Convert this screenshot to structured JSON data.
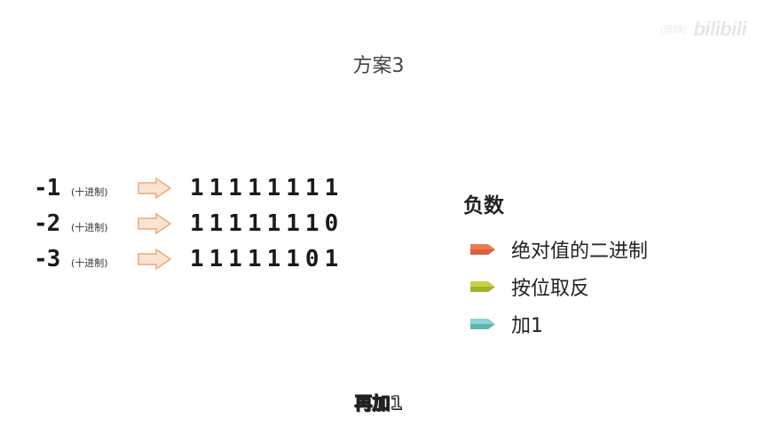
{
  "watermark": {
    "small_text": "(模糊)",
    "logo_text": "bilibili"
  },
  "title": "方案3",
  "rows": [
    {
      "number": "-1",
      "note": "(十进制)",
      "bits": "11111111"
    },
    {
      "number": "-2",
      "note": "(十进制)",
      "bits": "11111110"
    },
    {
      "number": "-3",
      "note": "(十进制)",
      "bits": "11111101"
    }
  ],
  "legend": {
    "heading": "负数",
    "items": [
      {
        "label": "绝对值的二进制",
        "color": "#ee7c50"
      },
      {
        "label": "按位取反",
        "color": "#b9c43a"
      },
      {
        "label": "加1",
        "color": "#74c7c5"
      }
    ]
  },
  "arrow_color": "#f6a878",
  "subtitle": "再加1"
}
